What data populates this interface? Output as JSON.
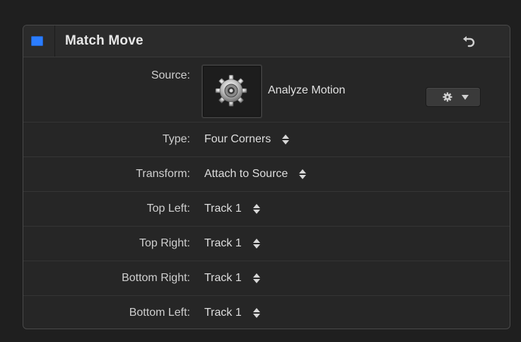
{
  "header": {
    "title": "Match Move",
    "enabled": true,
    "accent_color": "#2b7dff",
    "reset_icon": "reset-arrow-icon"
  },
  "source": {
    "label": "Source:",
    "well_icon": "gear-icon",
    "analyze_label": "Analyze Motion",
    "action_icon": "gear-icon"
  },
  "rows": [
    {
      "label": "Type:",
      "value": "Four Corners"
    },
    {
      "label": "Transform:",
      "value": "Attach to Source"
    },
    {
      "label": "Top Left:",
      "value": "Track 1"
    },
    {
      "label": "Top Right:",
      "value": "Track 1"
    },
    {
      "label": "Bottom Right:",
      "value": "Track 1"
    },
    {
      "label": "Bottom Left:",
      "value": "Track 1"
    }
  ]
}
